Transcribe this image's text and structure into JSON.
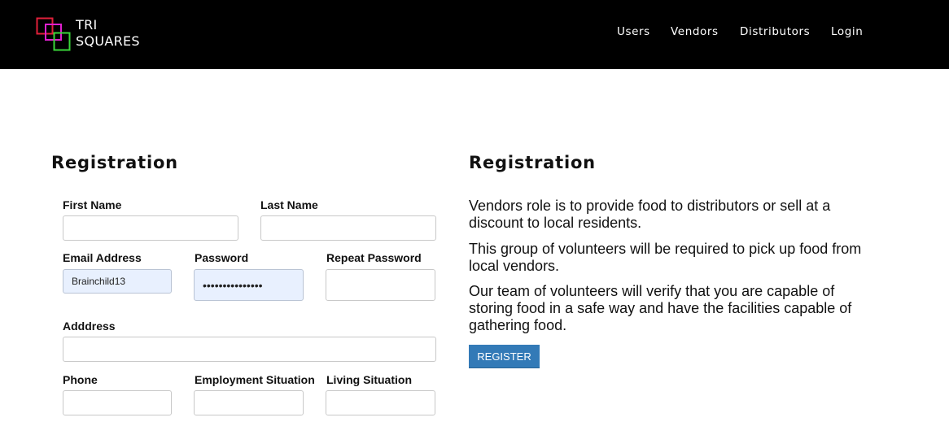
{
  "brand": {
    "line1": "TRI",
    "line2": "SQUARES"
  },
  "nav": [
    "Users",
    "Vendors",
    "Distributors",
    "Login"
  ],
  "form": {
    "heading": "Registration",
    "fields": {
      "first_name": {
        "label": "First Name",
        "value": ""
      },
      "last_name": {
        "label": "Last Name",
        "value": ""
      },
      "email": {
        "label": "Email Address",
        "value": "Brainchild13"
      },
      "password": {
        "label": "Password",
        "value": "•••••••••••••••"
      },
      "repeat_password": {
        "label": "Repeat Password",
        "value": ""
      },
      "address": {
        "label": "Adddress",
        "value": ""
      },
      "phone": {
        "label": "Phone",
        "value": ""
      },
      "employment": {
        "label": "Employment Situation",
        "value": ""
      },
      "living": {
        "label": "Living Situation",
        "value": ""
      }
    }
  },
  "info": {
    "heading": "Registration",
    "paragraphs": [
      "Vendors role is to provide food to distributors or sell at a discount to local residents.",
      "This group of volunteers will be required to pick up food from local vendors.",
      "Our team of volunteers will verify that you are capable of storing food in a safe way and have the facilities capable of gathering food."
    ],
    "register_label": "REGISTER"
  },
  "colors": {
    "navbar": "#000000",
    "logo_red": "#e0203a",
    "logo_magenta": "#e020d0",
    "logo_green": "#3ad63a",
    "button": "#337ab7",
    "autofill": "#e8f0fe"
  }
}
